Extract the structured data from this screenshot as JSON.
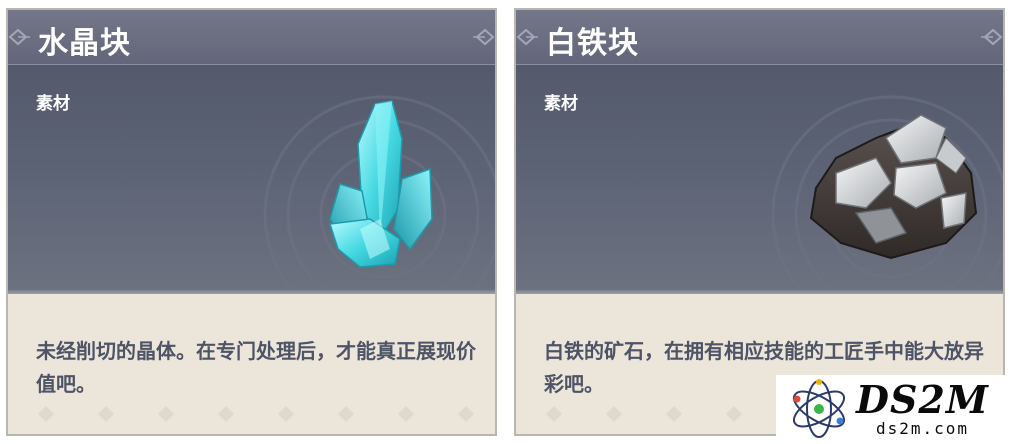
{
  "cards": [
    {
      "name": "水晶块",
      "category": "素材",
      "description": "未经削切的晶体。在专门处理后，才能真正展现价值吧。",
      "icon": "crystal-chunk-icon",
      "accent": "#4fe0e6"
    },
    {
      "name": "白铁块",
      "category": "素材",
      "description": "白铁的矿石，在拥有相应技能的工匠手中能大放异彩吧。",
      "icon": "white-iron-chunk-icon",
      "accent": "#d9dbdd"
    }
  ],
  "watermark": {
    "brand": "DS2M",
    "domain": "ds2m.com",
    "icon": "ds2m-atom-logo"
  }
}
